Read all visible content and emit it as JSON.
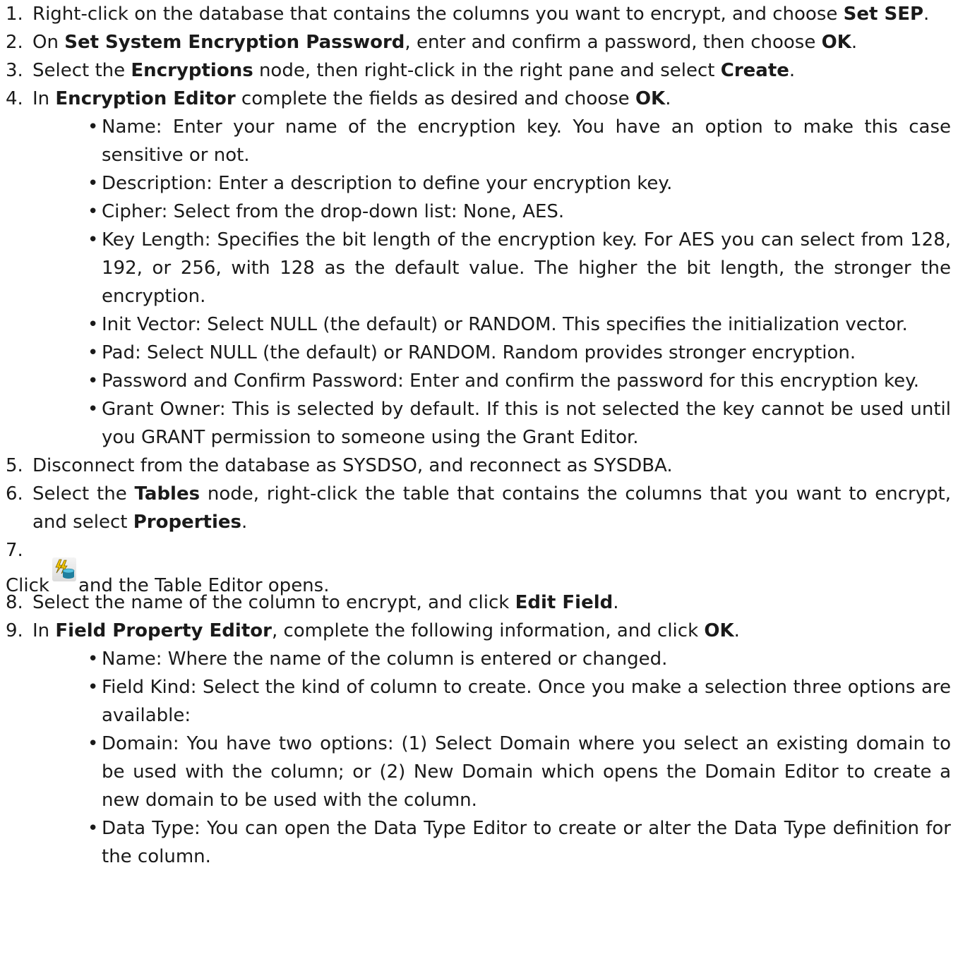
{
  "steps": [
    {
      "num": "1.",
      "parts": [
        "Right-click on the database that contains the columns you want to encrypt, and choose ",
        "Set SEP",
        "."
      ]
    },
    {
      "num": "2.",
      "parts": [
        "On ",
        "Set System Encryption Password",
        ", enter and confirm a password, then choose ",
        "OK",
        "."
      ]
    },
    {
      "num": "3.",
      "parts": [
        "Select the ",
        "Encryptions",
        " node, then right-click in the right pane and select ",
        "Create",
        "."
      ]
    },
    {
      "num": "4.",
      "parts": [
        "In ",
        "Encryption Editor",
        " complete the fields as desired and choose ",
        "OK",
        "."
      ],
      "bullets": [
        "Name: Enter your name of the encryption key. You have an option to make this case sensitive or not.",
        "Description: Enter a description to define your encryption key.",
        "Cipher: Select from the drop-down list: None, AES.",
        "Key Length: Specifies the bit length of the encryption key. For AES you can select from 128, 192, or 256, with 128 as the default value. The higher the bit length, the stronger the encryption.",
        "Init Vector: Select NULL (the default) or RANDOM. This specifies the initialization vector.",
        "Pad: Select NULL (the default) or RANDOM. Random provides stronger encryption.",
        "Password and Confirm Password: Enter and confirm the password for this encryption key.",
        "Grant Owner: This is selected by default. If this is not selected the key cannot be used until you GRANT permission to someone using the Grant Editor."
      ]
    },
    {
      "num": "5.",
      "text": "Disconnect from the database as SYSDSO, and reconnect as SYSDBA."
    },
    {
      "num": "6.",
      "parts": [
        "Select the ",
        "Tables",
        " node, right-click the table that contains the columns that you want to encrypt, and select ",
        "Properties",
        "."
      ]
    },
    {
      "num": "7.",
      "before": "Click",
      "after": "and the Table Editor opens.",
      "icon": "table-editor-icon"
    },
    {
      "num": "8.",
      "parts": [
        "Select the name of the column to encrypt, and click ",
        "Edit Field",
        "."
      ]
    },
    {
      "num": "9.",
      "parts": [
        "In ",
        "Field Property Editor",
        ", complete the following information, and click ",
        "OK",
        "."
      ],
      "bullets": [
        "Name: Where the name of the column is entered or changed.",
        "Field Kind: Select the kind of column to create. Once you make a selection three options are available:",
        "Domain: You have two options: (1) Select Domain where you select an existing domain to be used with the column; or (2) New Domain which opens the Domain Editor to create a new domain to be used with the column.",
        "Data Type: You can open the Data Type Editor to create or alter the Data Type definition for the column."
      ]
    }
  ],
  "colors": {
    "text": "#1a1a1a",
    "background": "#ffffff"
  }
}
